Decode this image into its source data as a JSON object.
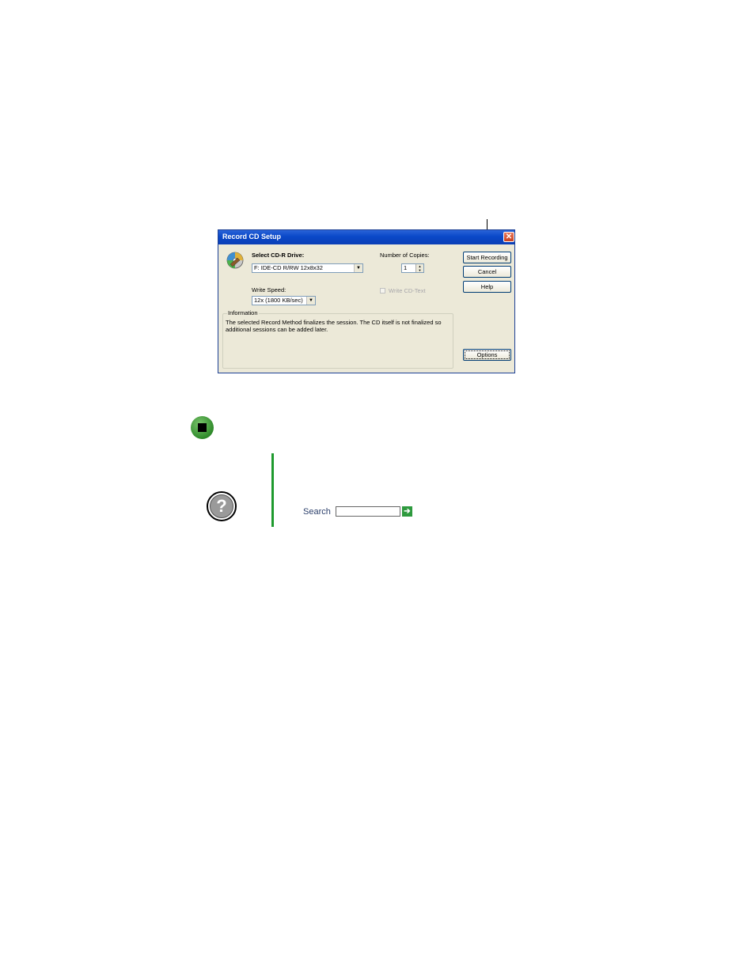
{
  "dialog": {
    "title": "Record CD Setup",
    "close_symbol": "✕",
    "drive_label": "Select CD-R Drive:",
    "drive_value": "F: IDE-CD R/RW 12x8x32",
    "copies_label": "Number of Copies:",
    "copies_value": "1",
    "speed_label": "Write Speed:",
    "speed_value": "12x (1800 KB/sec)",
    "write_cd_text_label": "Write CD-Text",
    "information_label": "Information",
    "information_text": "The selected Record Method finalizes the session. The CD itself is not finalized so additional sessions can be added later.",
    "buttons": {
      "start_recording": "Start Recording",
      "cancel": "Cancel",
      "help": "Help",
      "options": "Options"
    }
  },
  "help": {
    "search_label": "Search",
    "search_value": "",
    "help_symbol": "?",
    "go_symbol": "➔"
  },
  "colors": {
    "titlebar": "#0a48c8",
    "dialog_bg": "#ece9d8",
    "accent_green": "#1e9a2e"
  },
  "icons": [
    "cd-drive-icon",
    "close-icon",
    "dropdown-arrow-icon",
    "spinner-icon",
    "stop-icon",
    "help-question-icon",
    "go-arrow-icon"
  ]
}
